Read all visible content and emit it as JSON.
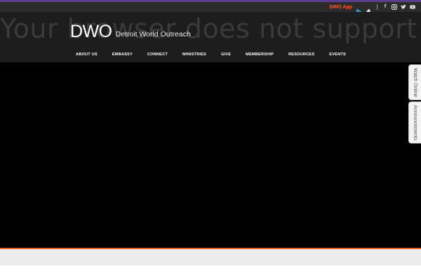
{
  "topbar": {
    "app_label": "DWO App",
    "app_icons": [
      "google-play-icon",
      "apple-icon"
    ],
    "social_icons": [
      "facebook-icon",
      "instagram-icon",
      "twitter-icon",
      "youtube-icon"
    ],
    "facebook_glyph": "f",
    "colors": {
      "app_label": "#ff5a1f",
      "purple_strip": "#5a3d8c"
    }
  },
  "header": {
    "background_text": "Your browser does not support the",
    "logo_mark": "DWO",
    "logo_name": "Detroit World Outreach"
  },
  "nav": {
    "items": [
      {
        "label": "ABOUT US"
      },
      {
        "label": "EMBASSY"
      },
      {
        "label": "CONNECT"
      },
      {
        "label": "MINISTRIES"
      },
      {
        "label": "GIVE"
      },
      {
        "label": "MEMBERSHIP"
      },
      {
        "label": "RESOURCES"
      },
      {
        "label": "EVENTS"
      }
    ]
  },
  "side_tabs": {
    "watch_online": "Watch Online",
    "announcements": "Announcements"
  },
  "colors": {
    "accent_orange": "#e8642a",
    "hero_bg": "#000000",
    "footer_band": "#ececec"
  }
}
